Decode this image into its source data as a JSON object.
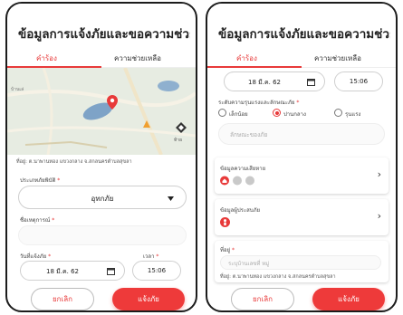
{
  "screen1": {
    "title": "ข้อมูลการแจ้งภัยและขอความช่วยเหลือ",
    "tabs": [
      "คำร้อง",
      "ความช่วยเหลือ"
    ],
    "map": {
      "place_label": "บ้านเล่",
      "marker_label": "ท้าย",
      "address": "ที่อยู่: ต.นาพานทอง แขวงกลาง จ.สกลนครตำบลสุขลา"
    },
    "fields": {
      "disaster_type_label": "ประเภทภัยพิบัติ",
      "disaster_type_value": "อุทกภัย",
      "event_name_label": "ชื่อเหตุการณ์",
      "date_label": "วันที่แจ้งภัย",
      "date_value": "18 มี.ค. 62",
      "time_label": "เวลา",
      "time_value": "15:06"
    },
    "buttons": {
      "cancel": "ยกเลิก",
      "submit": "แจ้งภัย"
    }
  },
  "screen2": {
    "title": "ข้อมูลการแจ้งภัยและขอความช่วยเหลือ",
    "tabs": [
      "คำร้อง",
      "ความช่วยเหลือ"
    ],
    "date_value": "18 มี.ค. 62",
    "time_value": "15:06",
    "severity": {
      "label": "ระดับความรุนแรงและลักษณะภัย",
      "options": [
        "เล็กน้อย",
        "ปานกลาง",
        "รุนแรง"
      ],
      "selected": "ปานกลาง"
    },
    "description_placeholder": "ลักษณะของภัย",
    "damage_card": {
      "label": "ข้อมูลความเสียหาย"
    },
    "victim_card": {
      "label": "ข้อมูลผู้ประสบภัย"
    },
    "address": {
      "label": "ที่อยู่",
      "placeholder": "ระบุบ้านเลขที่ หมู่",
      "current": "ที่อยู่: ต.นาพานทอง แขวงกลาง จ.สกลนครตำบลสุขลา"
    },
    "buttons": {
      "cancel": "ยกเลิก",
      "submit": "แจ้งภัย"
    }
  },
  "colors": {
    "accent": "#e83a3a",
    "map_water": "#7ea3c7",
    "map_land": "#e7ece2"
  }
}
